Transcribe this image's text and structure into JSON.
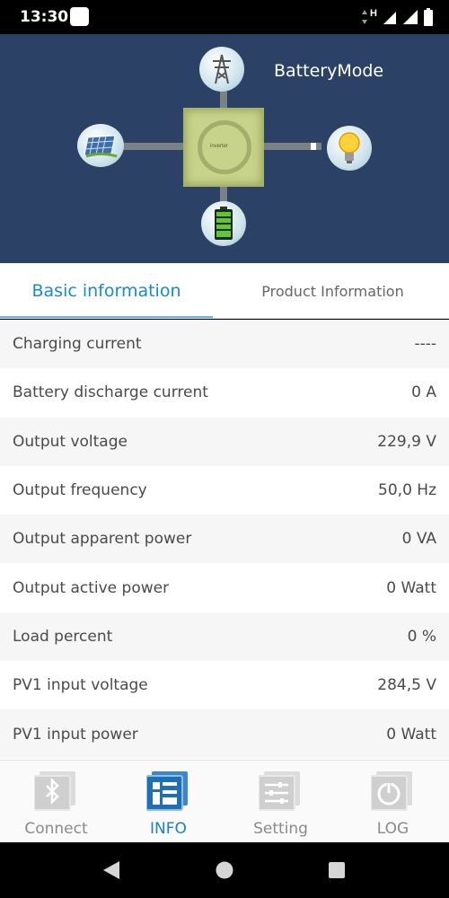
{
  "status_bar": {
    "time": "13:30",
    "icons": [
      "notification-icon",
      "data-arrows-icon",
      "signal-icon",
      "wifi-icon",
      "battery-icon"
    ],
    "network_label": "H"
  },
  "header": {
    "mode": "BatteryMode",
    "inverter_label": "inverter",
    "icons": [
      "grid-tower-icon",
      "solar-panel-icon",
      "lightbulb-icon",
      "battery-icon"
    ],
    "colors": {
      "background": "#2b4166",
      "inverter": "#c7d38a",
      "line": "#7b8286"
    }
  },
  "tabs": [
    {
      "label": "Basic information",
      "active": true
    },
    {
      "label": "Product Information",
      "active": false
    }
  ],
  "info_rows": [
    {
      "label": "Charging current",
      "value": "----"
    },
    {
      "label": "Battery discharge current",
      "value": "0 A"
    },
    {
      "label": "Output voltage",
      "value": "229,9 V"
    },
    {
      "label": "Output frequency",
      "value": "50,0 Hz"
    },
    {
      "label": "Output apparent power",
      "value": "0 VA"
    },
    {
      "label": "Output active power",
      "value": "0 Watt"
    },
    {
      "label": "Load percent",
      "value": "0 %"
    },
    {
      "label": "PV1 input voltage",
      "value": "284,5 V"
    },
    {
      "label": "PV1 input power",
      "value": "0 Watt"
    }
  ],
  "bottom_nav": [
    {
      "label": "Connect",
      "icon": "bluetooth-icon",
      "active": false
    },
    {
      "label": "INFO",
      "icon": "info-icon",
      "active": true
    },
    {
      "label": "Setting",
      "icon": "settings-sliders-icon",
      "active": false
    },
    {
      "label": "LOG",
      "icon": "power-log-icon",
      "active": false
    }
  ],
  "system_nav": [
    "back-icon",
    "home-icon",
    "recents-icon"
  ],
  "colors": {
    "accent": "#1a8bc4",
    "text": "#4a4a4a"
  }
}
